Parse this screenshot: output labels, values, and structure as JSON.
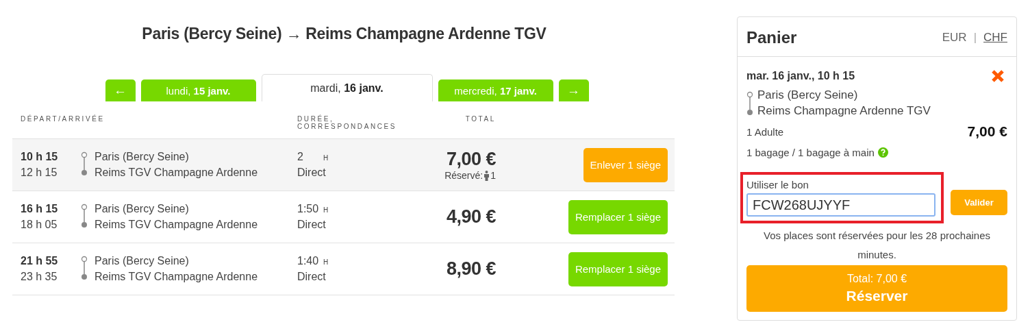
{
  "title": "Paris (Bercy Seine) → Reims Champagne Ardenne TGV",
  "date_nav": {
    "prev": "←",
    "next": "→",
    "days": [
      {
        "label": "lundi, **15 janv.**",
        "selected": false
      },
      {
        "label": "mardi, **16 janv.**",
        "selected": true
      },
      {
        "label": "mercredi, **17 janv.**",
        "selected": false
      }
    ]
  },
  "table": {
    "columns": [
      "DÉPART/ARRIVÉE",
      "DURÉE, CORRESPONDANCES",
      "TOTAL"
    ],
    "rows": [
      {
        "departure": "10 h 15",
        "arrival": "12 h 15",
        "from": "Paris (Bercy Seine)",
        "to": "Reims TGV Champagne Ardenne",
        "duration": "2",
        "duration_unit": "H",
        "connections": "Direct",
        "price": "7,00 €",
        "reserved_label": "Réservé:",
        "reserved_count": "1",
        "action": "Enlever 1 siège",
        "selected": true
      },
      {
        "departure": "16 h 15",
        "arrival": "18 h 05",
        "from": "Paris (Bercy Seine)",
        "to": "Reims TGV Champagne Ardenne",
        "duration": "1:50",
        "duration_unit": "H",
        "connections": "Direct",
        "price": "4,90 €",
        "action": "Remplacer 1 siège",
        "selected": false
      },
      {
        "departure": "21 h 55",
        "arrival": "23 h 35",
        "from": "Paris (Bercy Seine)",
        "to": "Reims TGV Champagne Ardenne",
        "duration": "1:40",
        "duration_unit": "H",
        "connections": "Direct",
        "price": "8,90 €",
        "action": "Remplacer 1 siège",
        "selected": false
      }
    ]
  },
  "cart": {
    "title": "Panier",
    "separator": "|",
    "currencies": [
      {
        "label": "EUR",
        "selected": true
      },
      {
        "label": "CHF",
        "selected": false
      }
    ],
    "item": {
      "date": "mar. 16 janv., 10 h 15",
      "from": "Paris (Bercy Seine)",
      "to": "Reims Champagne Ardenne TGV",
      "passengers": "1 Adulte",
      "price": "7,00 €",
      "baggage": "1 bagage / 1 bagage à main"
    },
    "coupon": {
      "label": "Utiliser le bon",
      "value": "FCW268UJYYF",
      "button": "Valider",
      "highlighted": true
    },
    "notice": "Vos places sont réservées pour les 28 prochaines minutes.",
    "total": "Total: 7,00 €",
    "book": "Réserver"
  }
}
